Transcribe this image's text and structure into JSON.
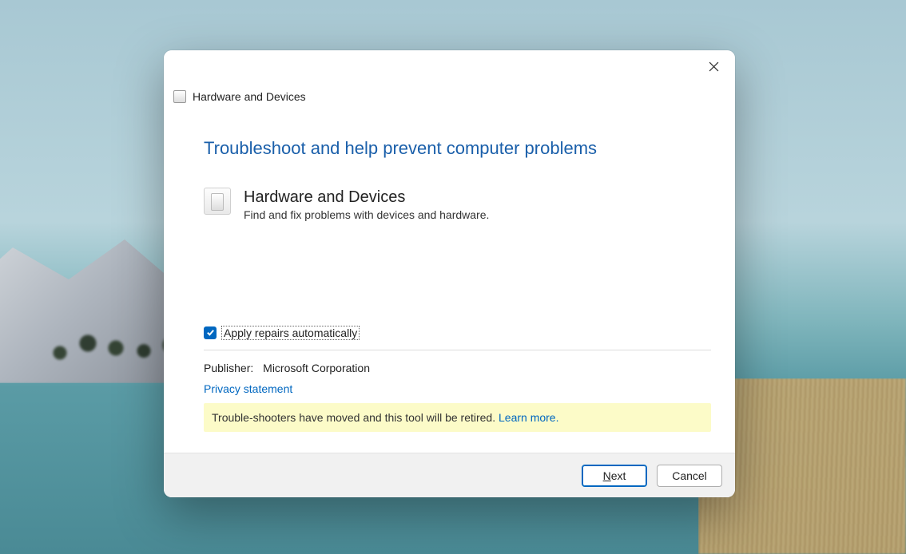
{
  "window": {
    "title": "Hardware and Devices"
  },
  "page": {
    "heading": "Troubleshoot and help prevent computer problems",
    "troubleshooter": {
      "name": "Hardware and Devices",
      "description": "Find and fix problems with devices and hardware."
    },
    "repairs_checkbox": {
      "label": "Apply repairs automatically",
      "checked": true
    },
    "publisher_label": "Publisher:",
    "publisher_value": "Microsoft Corporation",
    "privacy_link": "Privacy statement",
    "notice_text": "Trouble-shooters have moved and this tool will be retired. ",
    "notice_link": "Learn more."
  },
  "buttons": {
    "next_prefix": "N",
    "next_suffix": "ext",
    "cancel": "Cancel"
  }
}
